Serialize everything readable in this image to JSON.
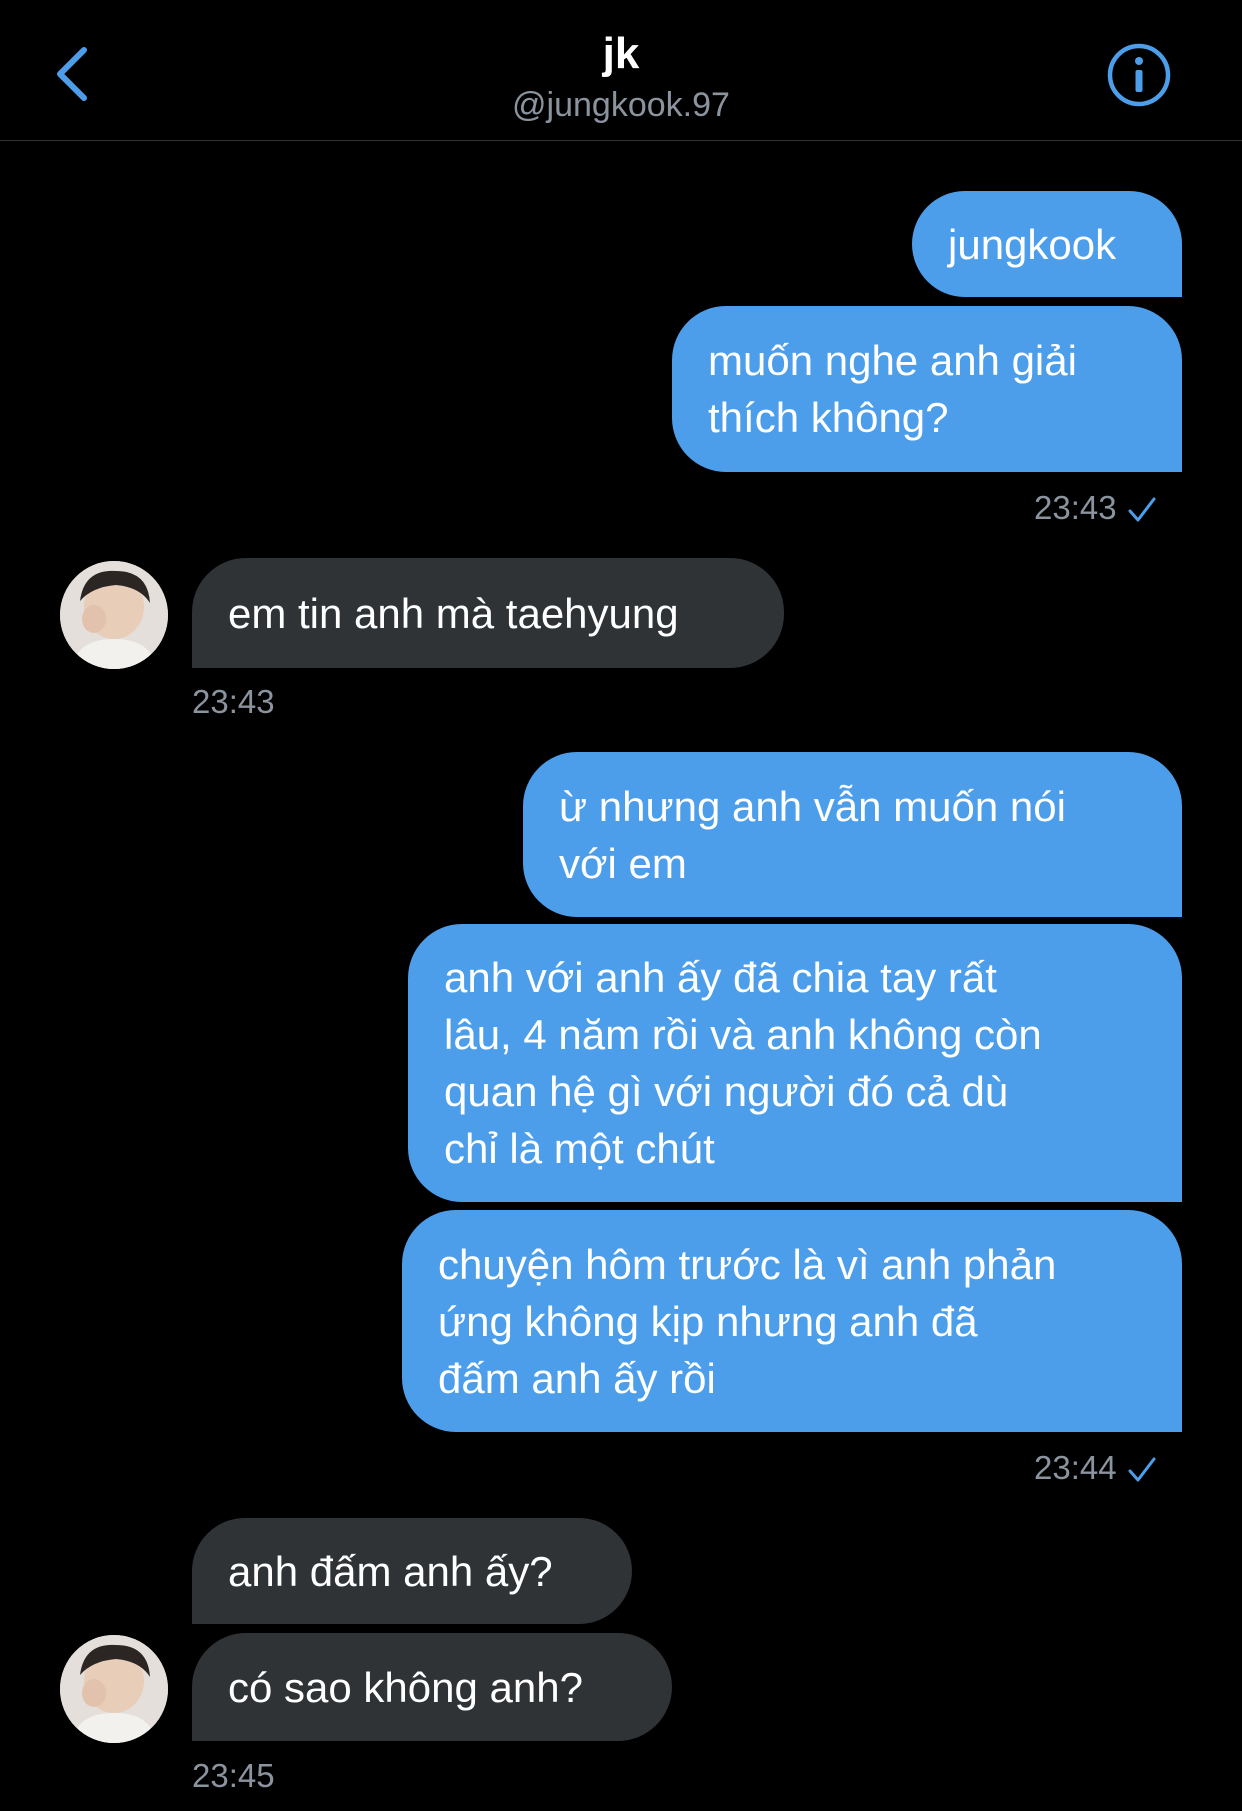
{
  "header": {
    "title": "jk",
    "handle": "@jungkook.97"
  },
  "colors": {
    "accent": "#4c9eea",
    "received_bubble": "#2f3336",
    "background": "#000000",
    "timestamp": "#8b949e"
  },
  "messages": [
    {
      "from": "me",
      "lines": [
        "jungkook"
      ]
    },
    {
      "from": "me",
      "lines": [
        "muốn nghe anh giải",
        "thích không?"
      ]
    },
    {
      "from": "me",
      "timestamp": "23:43",
      "read": true
    },
    {
      "from": "them",
      "lines": [
        "em tin anh mà taehyung"
      ]
    },
    {
      "from": "them",
      "timestamp": "23:43"
    },
    {
      "from": "me",
      "lines": [
        "ừ nhưng anh vẫn muốn nói",
        "với em"
      ]
    },
    {
      "from": "me",
      "lines": [
        "anh với anh ấy đã chia tay rất",
        "lâu, 4 năm rồi và anh không còn",
        "quan hệ gì với người đó cả dù",
        "chỉ là một chút"
      ]
    },
    {
      "from": "me",
      "lines": [
        "chuyện hôm trước là vì anh phản",
        "ứng không kịp nhưng anh đã",
        "đấm anh ấy rồi"
      ]
    },
    {
      "from": "me",
      "timestamp": "23:44",
      "read": true
    },
    {
      "from": "them",
      "lines": [
        "anh đấm anh ấy?"
      ]
    },
    {
      "from": "them",
      "lines": [
        "có sao không anh?"
      ]
    },
    {
      "from": "them",
      "timestamp": "23:45"
    }
  ]
}
